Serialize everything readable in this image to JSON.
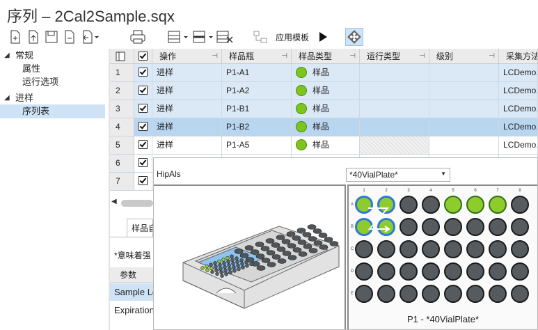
{
  "window": {
    "title": "序列 – 2Cal2Sample.sqx"
  },
  "toolbar": {
    "apply_template_label": "应用模板"
  },
  "nav": {
    "groups": [
      {
        "label": "常规",
        "items": [
          "属性",
          "运行选项"
        ]
      },
      {
        "label": "进样",
        "items": [
          "序列表"
        ]
      }
    ],
    "selected": "序列表"
  },
  "grid": {
    "columns": [
      "操作",
      "样品瓶",
      "样品类型",
      "运行类型",
      "级别",
      "采集方法"
    ],
    "rows": [
      {
        "num": "1",
        "checked": true,
        "action": "进样",
        "vial": "P1-A1",
        "type": "样品",
        "acq": "LCDemo.a"
      },
      {
        "num": "2",
        "checked": true,
        "action": "进样",
        "vial": "P1-A2",
        "type": "样品",
        "acq": "LCDemo.a"
      },
      {
        "num": "3",
        "checked": true,
        "action": "进样",
        "vial": "P1-B1",
        "type": "样品",
        "acq": "LCDemo.a"
      },
      {
        "num": "4",
        "checked": true,
        "action": "进样",
        "vial": "P1-B2",
        "type": "样品",
        "acq": "LCDemo.a"
      },
      {
        "num": "5",
        "checked": true,
        "action": "进样",
        "vial": "P1-A5",
        "type": "样品",
        "acq": "LCDemo.a"
      },
      {
        "num": "6",
        "checked": true
      },
      {
        "num": "7",
        "checked": true
      }
    ]
  },
  "lower": {
    "tab_label": "样品自",
    "note": "*意味着强",
    "param_header": "参数",
    "items": [
      "Sample Lo",
      "Expiration"
    ]
  },
  "vial_popup": {
    "device_label": "HipAls",
    "plate_select": "*40VialPlate*",
    "plate_caption": "P1 - *40VialPlate*",
    "columns": [
      "1",
      "2",
      "3",
      "4",
      "5",
      "6",
      "7",
      "8"
    ],
    "rows": [
      "A",
      "B",
      "C",
      "D",
      "E"
    ],
    "selected_wells": [
      "A1",
      "A2",
      "B1",
      "B2"
    ],
    "green_wells": [
      "A5",
      "A6",
      "A7"
    ]
  },
  "colors": {
    "selection": "#cfe3f6",
    "row_selected": "#b9d6f1",
    "row": "#dbe9f7",
    "vial_green": "#8dcc2c",
    "vial_empty": "#555b5f",
    "vial_selected_ring": "#2b7ad6"
  }
}
